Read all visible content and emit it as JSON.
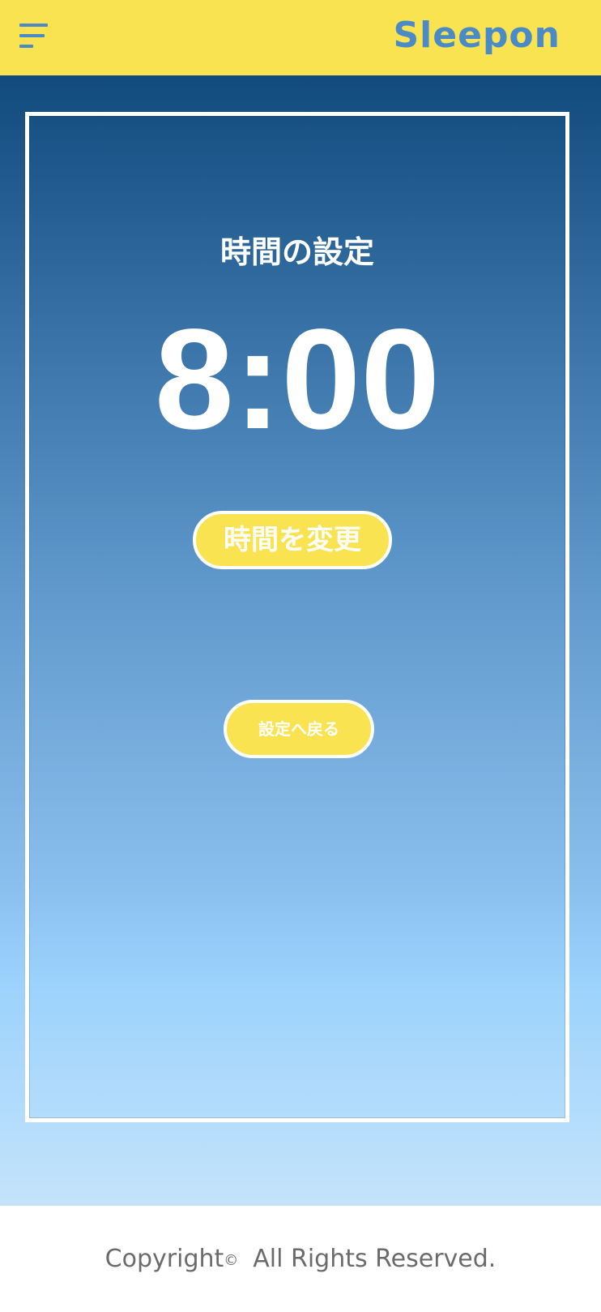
{
  "header": {
    "menu_icon": "hamburger-menu-icon",
    "logo_text": "Sleepon",
    "background_color": "#fae350",
    "accent_color": "#4a8ac6"
  },
  "main": {
    "title": "時間の設定",
    "time": "8:00",
    "change_time_label": "時間を変更",
    "back_to_settings_label": "設定へ戻る"
  },
  "footer": {
    "copyright_word": "Copyright",
    "copyright_symbol": "©",
    "rights_text": "All Rights Reserved."
  }
}
